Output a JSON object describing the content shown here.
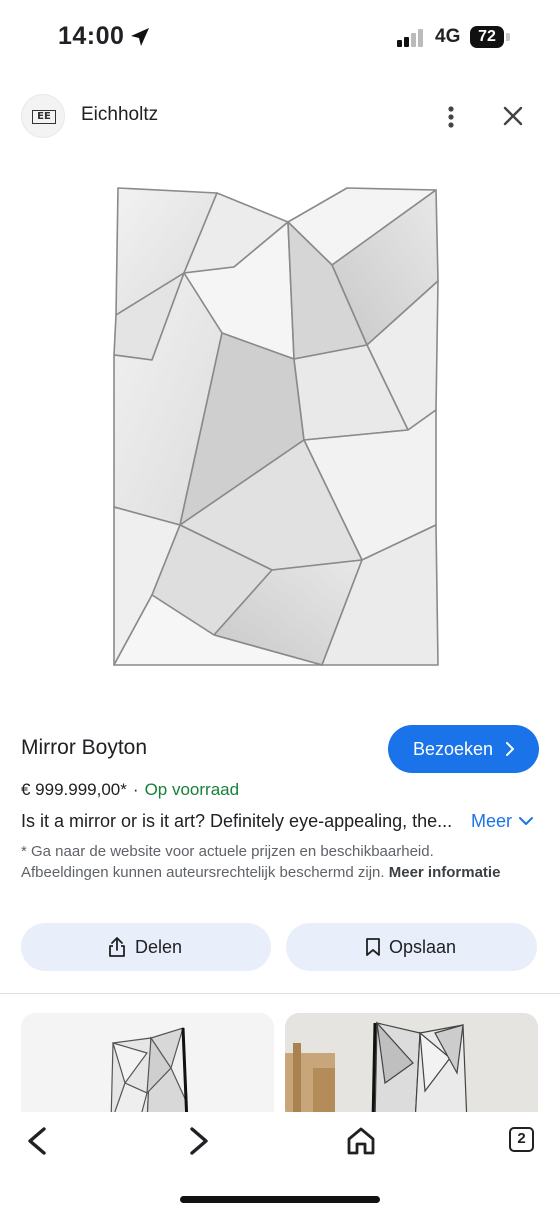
{
  "status_bar": {
    "time": "14:00",
    "network": "4G",
    "battery": "72"
  },
  "source": {
    "name": "Eichholtz",
    "logo_text": "EE"
  },
  "product": {
    "title": "Mirror Boyton",
    "visit_label": "Bezoeken",
    "price": "€ 999.999,00*",
    "separator": "·",
    "stock": "Op voorraad",
    "description": "Is it a mirror or is it art? Definitely eye-appealing, the...",
    "more_label": "Meer",
    "disclaimer": "* Ga naar de website voor actuele prijzen en beschikbaarheid. Afbeeldingen kunnen auteursrechtelijk beschermd zijn.",
    "disclaimer_link": "Meer informatie"
  },
  "actions": {
    "share_label": "Delen",
    "save_label": "Opslaan"
  },
  "bottom_nav": {
    "tab_count": "2"
  },
  "colors": {
    "accent": "#1a73e8",
    "stock_green": "#188038",
    "action_bg": "#e8effa"
  }
}
